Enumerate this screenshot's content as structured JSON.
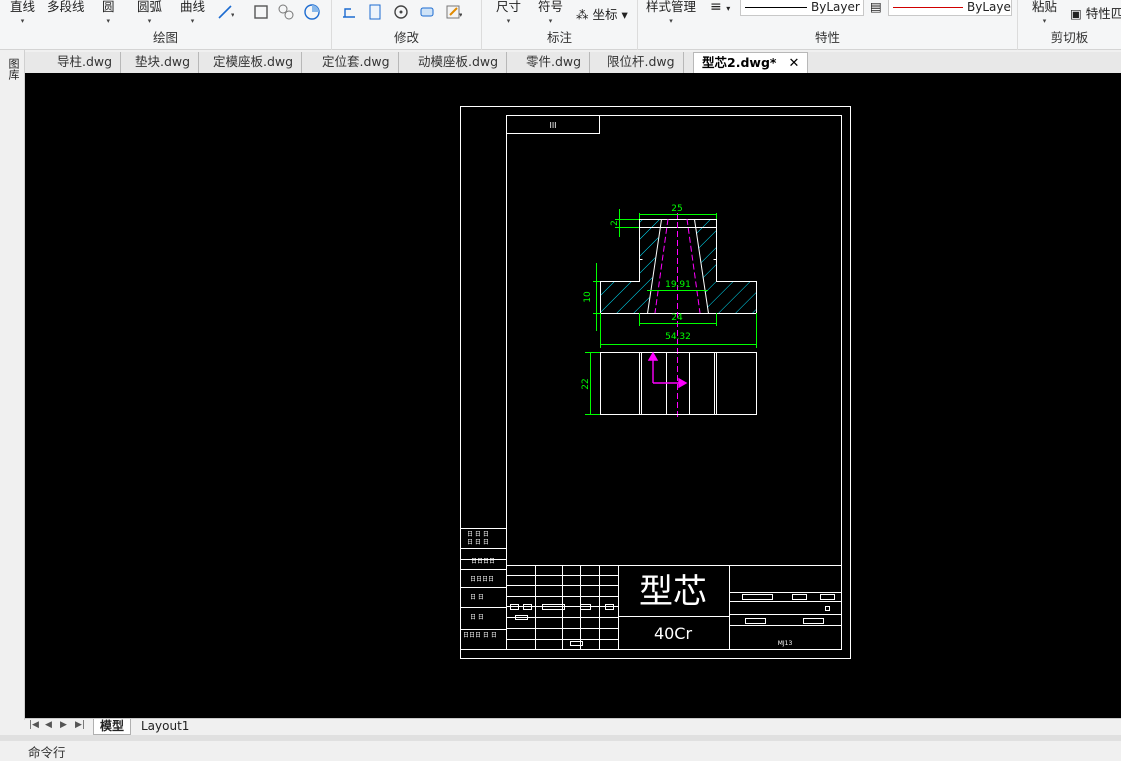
{
  "ribbon": {
    "draw": {
      "label": "绘图",
      "line": "直线",
      "polyline": "多段线",
      "circle": "圆",
      "arc": "圆弧",
      "curve": "曲线"
    },
    "modify": {
      "label": "修改"
    },
    "annotate": {
      "label": "标注",
      "dimension": "尺寸",
      "symbol": "符号",
      "coordinate": "坐标"
    },
    "properties": {
      "label": "特性",
      "style_manager": "样式管理",
      "linetype": "ByLayer",
      "color": "ByLayer"
    },
    "clipboard": {
      "label": "剪切板",
      "paste": "粘贴",
      "match_properties": "特性匹"
    }
  },
  "left_panel": {
    "label": "图库"
  },
  "doc_tabs": [
    {
      "label": "导柱.dwg"
    },
    {
      "label": "垫块.dwg"
    },
    {
      "label": "定模座板.dwg"
    },
    {
      "label": "定位套.dwg"
    },
    {
      "label": "动模座板.dwg"
    },
    {
      "label": "零件.dwg"
    },
    {
      "label": "限位杆.dwg"
    },
    {
      "label": "型芯2.dwg*",
      "active": true
    }
  ],
  "drawing": {
    "corner_label": "III",
    "part_name": "型芯",
    "material": "40Cr",
    "drawing_code": "MJ13",
    "dims": {
      "top_width": "25",
      "chamfer": "2",
      "inner": "19.91",
      "flange_height": "10",
      "base_inner": "24",
      "flange_width": "54.32",
      "body_height": "22"
    },
    "colors": {
      "outline": "#ffffff",
      "dimension": "#00ff00",
      "hatch": "#00e5ff",
      "center": "#ff00ff"
    }
  },
  "layout_tabs": [
    {
      "label": "模型",
      "active": true
    },
    {
      "label": "Layout1"
    }
  ],
  "command_line": {
    "prompt": "命令行"
  }
}
